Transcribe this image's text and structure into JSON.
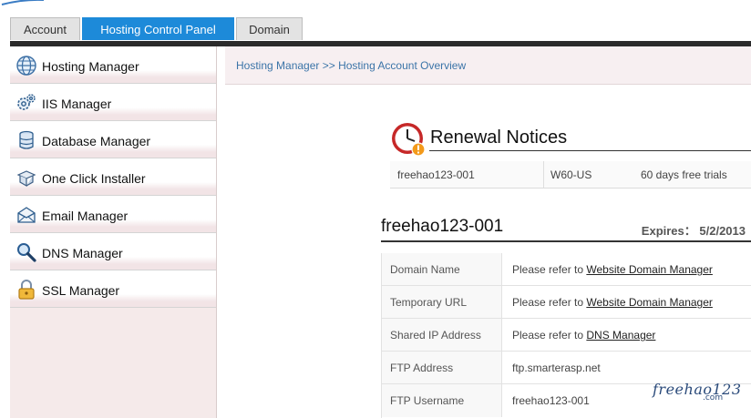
{
  "tabs": [
    {
      "label": "Account",
      "active": false
    },
    {
      "label": "Hosting Control Panel",
      "active": true
    },
    {
      "label": "Domain",
      "active": false
    }
  ],
  "sidebar": {
    "items": [
      {
        "label": "Hosting Manager",
        "icon": "globe-icon"
      },
      {
        "label": "IIS Manager",
        "icon": "gears-icon"
      },
      {
        "label": "Database Manager",
        "icon": "database-icon"
      },
      {
        "label": "One Click Installer",
        "icon": "package-icon"
      },
      {
        "label": "Email Manager",
        "icon": "envelope-icon"
      },
      {
        "label": "DNS Manager",
        "icon": "magnifier-icon"
      },
      {
        "label": "SSL Manager",
        "icon": "lock-icon"
      }
    ]
  },
  "breadcrumb": "Hosting Manager >> Hosting Account Overview",
  "renewal": {
    "title": "Renewal Notices",
    "row": {
      "account": "freehao123-001",
      "plan": "W60-US",
      "note": "60 days free trials"
    }
  },
  "account": {
    "name": "freehao123-001",
    "expires": "Expires： 5/2/2013"
  },
  "info_rows": [
    {
      "key": "Domain Name",
      "prefix": "Please refer to ",
      "link": "Website Domain Manager"
    },
    {
      "key": "Temporary URL",
      "prefix": "Please refer to ",
      "link": "Website Domain Manager"
    },
    {
      "key": "Shared IP Address",
      "prefix": "Please refer to ",
      "link": "DNS Manager"
    },
    {
      "key": "FTP Address",
      "value": "ftp.smarterasp.net"
    },
    {
      "key": "FTP Username",
      "value": "freehao123-001"
    }
  ],
  "watermark": {
    "main": "freehao123",
    "sub": ".com"
  },
  "colors": {
    "active_tab": "#1d8ad9",
    "topbar": "#2b2b2b",
    "sidebar_bg": "#f5eaea",
    "link": "#3b74a8"
  }
}
